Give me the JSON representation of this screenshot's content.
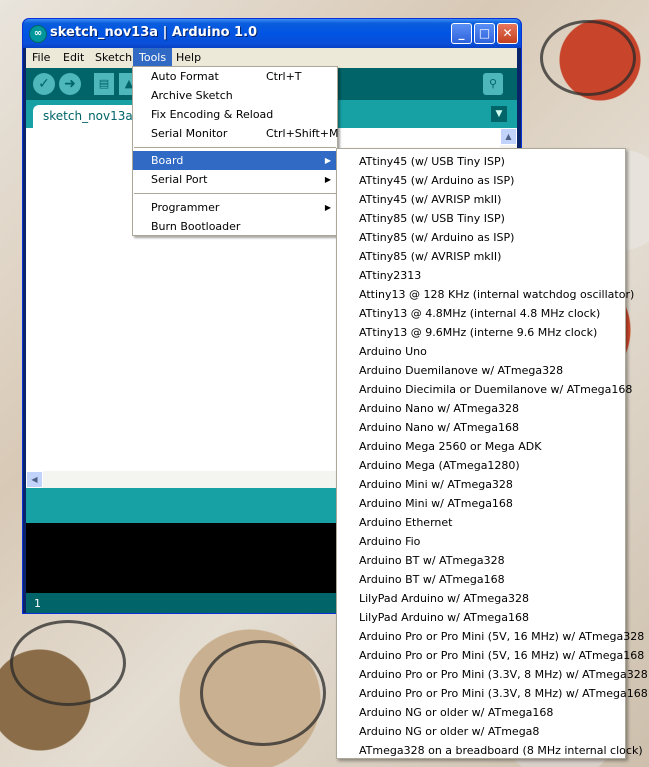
{
  "window": {
    "title": "sketch_nov13a | Arduino 1.0",
    "app_icon": "arduino-logo-icon",
    "controls": {
      "minimize": "_",
      "maximize": "□",
      "close": "✕"
    }
  },
  "menubar": {
    "items": [
      "File",
      "Edit",
      "Sketch",
      "Tools",
      "Help"
    ],
    "active": "Tools"
  },
  "toolbar": {
    "icons": [
      "verify-icon",
      "upload-icon",
      "new-icon",
      "open-icon",
      "serial-monitor-icon"
    ]
  },
  "tabs": {
    "current": "sketch_nov13a"
  },
  "status": {
    "line": "1"
  },
  "tools_menu": {
    "items": [
      {
        "label": "Auto Format",
        "shortcut": "Ctrl+T"
      },
      {
        "label": "Archive Sketch",
        "shortcut": ""
      },
      {
        "label": "Fix Encoding & Reload",
        "shortcut": ""
      },
      {
        "label": "Serial Monitor",
        "shortcut": "Ctrl+Shift+M"
      },
      {
        "label": "Board",
        "shortcut": ""
      },
      {
        "label": "Serial Port",
        "shortcut": ""
      },
      {
        "label": "Programmer",
        "shortcut": ""
      },
      {
        "label": "Burn Bootloader",
        "shortcut": ""
      }
    ],
    "highlighted": "Board"
  },
  "board_menu": {
    "items": [
      "ATtiny45 (w/ USB Tiny ISP)",
      "ATtiny45 (w/ Arduino as ISP)",
      "ATtiny45 (w/ AVRISP mkII)",
      "ATtiny85 (w/ USB Tiny ISP)",
      "ATtiny85 (w/ Arduino as ISP)",
      "ATtiny85 (w/ AVRISP mkII)",
      "ATtiny2313",
      "Attiny13 @ 128 KHz (internal watchdog oscillator)",
      "ATtiny13 @ 4.8MHz (internal 4.8 MHz clock)",
      "ATtiny13 @ 9.6MHz (interne 9.6 MHz clock)",
      "Arduino Uno",
      "Arduino Duemilanove w/ ATmega328",
      "Arduino Diecimila or Duemilanove w/ ATmega168",
      "Arduino Nano w/ ATmega328",
      "Arduino Nano w/ ATmega168",
      "Arduino Mega 2560 or Mega ADK",
      "Arduino Mega (ATmega1280)",
      "Arduino Mini w/ ATmega328",
      "Arduino Mini w/ ATmega168",
      "Arduino Ethernet",
      "Arduino Fio",
      "Arduino BT w/ ATmega328",
      "Arduino BT w/ ATmega168",
      "LilyPad Arduino w/ ATmega328",
      "LilyPad Arduino w/ ATmega168",
      "Arduino Pro or Pro Mini (5V, 16 MHz) w/ ATmega328",
      "Arduino Pro or Pro Mini (5V, 16 MHz) w/ ATmega168",
      "Arduino Pro or Pro Mini (3.3V, 8 MHz) w/ ATmega328",
      "Arduino Pro or Pro Mini (3.3V, 8 MHz) w/ ATmega168",
      "Arduino NG or older w/ ATmega168",
      "Arduino NG or older w/ ATmega8",
      "ATmega328 on a breadboard (8 MHz internal clock)"
    ]
  },
  "colors": {
    "arduino_teal_dark": "#006468",
    "arduino_teal": "#17a1a5",
    "menu_highlight": "#316ac5",
    "xp_title_blue": "#0054e3"
  }
}
